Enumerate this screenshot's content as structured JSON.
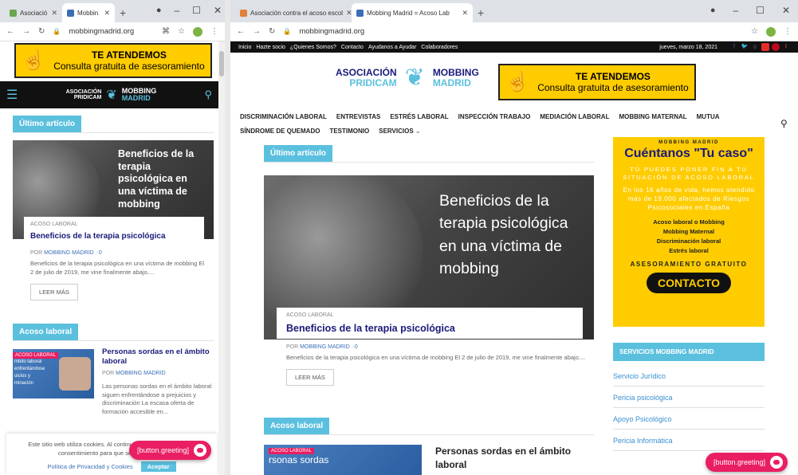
{
  "left": {
    "tabs": [
      {
        "label": "Asociació"
      },
      {
        "label": "Mobbin"
      }
    ],
    "url": "mobbingmadrid.org",
    "banner": {
      "line1": "TE ATENDEMOS",
      "line2": "Consulta gratuita de asesoramiento"
    },
    "logo": {
      "left1": "ASOCIACIÓN",
      "left2": "PRIDICAM",
      "right1": "MOBBING",
      "right2": "MADRID"
    },
    "latest_label": "Último artículo",
    "hero_text": "Beneficios de la terapia psicológica en una víctima de mobbing",
    "article": {
      "category": "ACOSO LABORAL",
      "title": "Beneficios de la terapia psicológica",
      "by": "POR",
      "author": "MOBBING MADRID",
      "comments": "0",
      "excerpt": "Beneficios de la terapia psicológica en una víctima de mobbing El 2 de julio de 2019, me vine finalmente abajo....",
      "more": "LEER MÁS"
    },
    "acoso_label": "Acoso laboral",
    "post2": {
      "thumb_badge": "ACOSO LABORAL",
      "thumb_lines": [
        "mbito laboral",
        "enfrentándose",
        "uicios y",
        "minación"
      ],
      "title": "Personas sordas en el ámbito laboral",
      "by": "POR",
      "author": "MOBBING MADRID",
      "excerpt": "Las personas sordas en el ámbito laboral siguen enfrentándose a prejuicios y discriminación La escasa oferta de formación accesible en..."
    },
    "cookie": {
      "text": "Este sitio web utiliza cookies. Al continuar u dando su consentimiento para que se uti",
      "link": "Política de Privacidad y Cookies",
      "accept": "Aceptar"
    },
    "greeting": "[button.greeting]"
  },
  "right": {
    "tabs": [
      {
        "label": "Asociación contra el acoso escol"
      },
      {
        "label": "Mobbing Madrid = Acoso Lab"
      }
    ],
    "url": "mobbingmadrid.org",
    "topnav": [
      "Inicio",
      "Hazte socio",
      "¿Quienes Somos?",
      "Contacto",
      "Ayudanos a Ayudar",
      "Colaboradores"
    ],
    "date": "jueves, marzo 18, 2021",
    "logo": {
      "left1": "ASOCIACIÓN",
      "left2": "PRIDICAM",
      "right1": "MOBBING",
      "right2": "MADRID"
    },
    "banner": {
      "line1": "TE ATENDEMOS",
      "line2": "Consulta gratuita de asesoramiento"
    },
    "menu": [
      "DISCRIMINACIÓN LABORAL",
      "ENTREVISTAS",
      "ESTRÉS LABORAL",
      "INSPECCIÓN TRABAJO",
      "MEDIACIÓN LABORAL",
      "MOBBING MATERNAL",
      "MUTUA",
      "SÍNDROME DE QUEMADO",
      "TESTIMONIO",
      "SERVICIOS"
    ],
    "latest_label": "Último artículo",
    "hero_text": "Beneficios de la terapia psicológica en una víctima de mobbing",
    "article": {
      "category": "ACOSO LABORAL",
      "title": "Beneficios de la terapia psicológica",
      "by": "POR",
      "author": "MOBBING MADRID",
      "comments": "0",
      "excerpt": "Beneficios de la terapia psicológica en una víctima de mobbing El 2 de julio de 2019, me vine finalmente abajo....",
      "more": "LEER MÁS"
    },
    "acoso_label": "Acoso laboral",
    "post2": {
      "thumb_badge": "ACOSO LABORAL",
      "thumb_text": "rsonas sordas",
      "title": "Personas sordas en el ámbito laboral"
    },
    "side": {
      "kicker": "MOBBING MADRID",
      "headline": "Cuéntanos \"Tu caso\"",
      "sub": "TÚ PUEDES PONER FIN A TU SITUACIÓN DE ACOSO LABORAL",
      "body": "En los 16 años de vida, hemos atendido más de 19.000 afectados de Riesgos Psicosociales en España",
      "items": [
        "Acoso laboral o Mobbing",
        "Mobbing Maternal",
        "Discriminación laboral",
        "Estrés laboral"
      ],
      "free": "ASESORAMIENTO GRATUITO",
      "cta": "CONTACTO"
    },
    "services_label": "SERVICIOS MOBBING MADRID",
    "services": [
      "Servicio Jurídico",
      "Pericia psicológica",
      "Apoyo Psicológico",
      "Pericia Informática"
    ],
    "greeting": "[button.greeting]"
  },
  "colors": {
    "accent": "#5bc0de",
    "banner": "#ffcc00",
    "pink": "#e91e63",
    "title": "#1a1a7a"
  }
}
